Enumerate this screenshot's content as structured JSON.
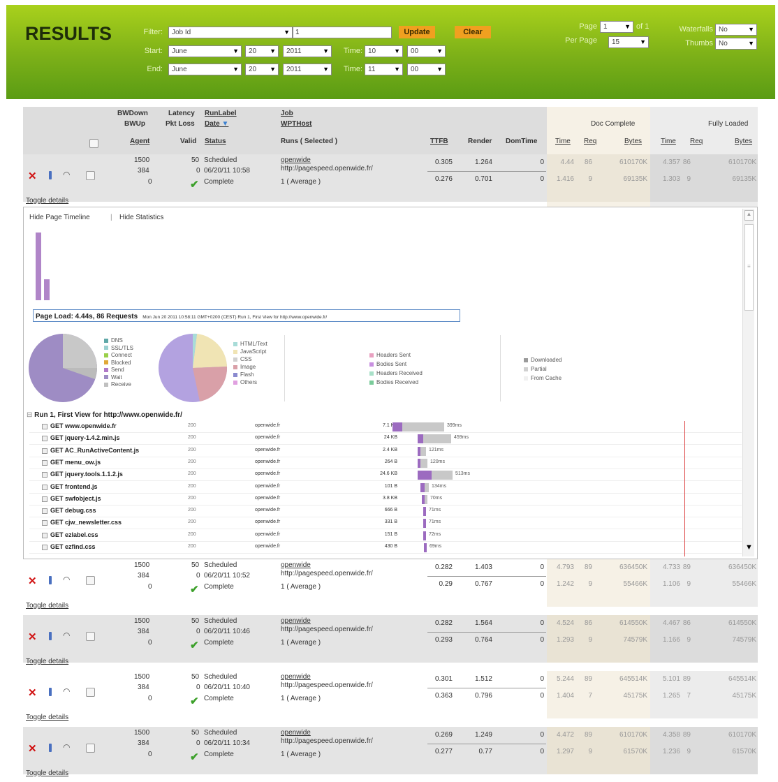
{
  "header": {
    "title": "RESULTS",
    "filter_label": "Filter:",
    "filter_value": "Job Id",
    "filter_input": "1",
    "update": "Update",
    "clear": "Clear",
    "start_label": "Start:",
    "end_label": "End:",
    "time_label": "Time:",
    "start": {
      "month": "June",
      "day": "20",
      "year": "2011",
      "hour": "10",
      "min": "00"
    },
    "end": {
      "month": "June",
      "day": "20",
      "year": "2011",
      "hour": "11",
      "min": "00"
    },
    "page_label": "Page",
    "page_value": "1",
    "of_label": "of 1",
    "perpage_label": "Per Page",
    "perpage_value": "15",
    "waterfalls_label": "Waterfalls",
    "waterfalls_value": "No",
    "thumbs_label": "Thumbs",
    "thumbs_value": "No"
  },
  "cols": {
    "bwdown": "BWDown",
    "bwup": "BWUp",
    "agent": "Agent",
    "latency": "Latency",
    "pktloss": "Pkt Loss",
    "valid": "Valid",
    "runlabel": "RunLabel",
    "date": "Date",
    "status": "Status",
    "job": "Job",
    "wpthost": "WPTHost",
    "runs": "Runs ( Selected )",
    "ttfb": "TTFB",
    "render": "Render",
    "domtime": "DomTime",
    "doc_complete": "Doc Complete",
    "fully_loaded": "Fully Loaded",
    "time": "Time",
    "req": "Req",
    "bytes": "Bytes"
  },
  "rows": [
    {
      "bw1": "1500",
      "bw2": "384",
      "bw3": "0",
      "valid": "50",
      "pkt": "0",
      "scheduled": "Scheduled",
      "date": "06/20/11 10:58",
      "status": "Complete",
      "job": "openwide",
      "url": "http://pagespeed.openwide.fr/",
      "run": "1 ( Average )",
      "ttfb1": "0.305",
      "ttfb2": "0.276",
      "render1": "1.264",
      "render2": "0.701",
      "dom1": "0",
      "dom2": "0",
      "dt1": "4.44",
      "dt2": "1.416",
      "dr1": "86",
      "dr2": "9",
      "db1": "610170K",
      "db2": "69135K",
      "ft1": "4.357",
      "ft2": "1.303",
      "fr1": "86",
      "fr2": "9",
      "fb1": "610170K",
      "fb2": "69135K",
      "toggle": "Toggle details"
    },
    {
      "bw1": "1500",
      "bw2": "384",
      "bw3": "0",
      "valid": "50",
      "pkt": "0",
      "scheduled": "Scheduled",
      "date": "06/20/11 10:52",
      "status": "Complete",
      "job": "openwide",
      "url": "http://pagespeed.openwide.fr/",
      "run": "1 ( Average )",
      "ttfb1": "0.282",
      "ttfb2": "0.29",
      "render1": "1.403",
      "render2": "0.767",
      "dom1": "0",
      "dom2": "0",
      "dt1": "4.793",
      "dt2": "1.242",
      "dr1": "89",
      "dr2": "9",
      "db1": "636450K",
      "db2": "55466K",
      "ft1": "4.733",
      "ft2": "1.106",
      "fr1": "89",
      "fr2": "9",
      "fb1": "636450K",
      "fb2": "55466K",
      "toggle": "Toggle details"
    },
    {
      "bw1": "1500",
      "bw2": "384",
      "bw3": "0",
      "valid": "50",
      "pkt": "0",
      "scheduled": "Scheduled",
      "date": "06/20/11 10:46",
      "status": "Complete",
      "job": "openwide",
      "url": "http://pagespeed.openwide.fr/",
      "run": "1 ( Average )",
      "ttfb1": "0.282",
      "ttfb2": "0.293",
      "render1": "1.564",
      "render2": "0.764",
      "dom1": "0",
      "dom2": "0",
      "dt1": "4.524",
      "dt2": "1.293",
      "dr1": "86",
      "dr2": "9",
      "db1": "614550K",
      "db2": "74579K",
      "ft1": "4.467",
      "ft2": "1.166",
      "fr1": "86",
      "fr2": "9",
      "fb1": "614550K",
      "fb2": "74579K",
      "toggle": "Toggle details"
    },
    {
      "bw1": "1500",
      "bw2": "384",
      "bw3": "0",
      "valid": "50",
      "pkt": "0",
      "scheduled": "Scheduled",
      "date": "06/20/11 10:40",
      "status": "Complete",
      "job": "openwide",
      "url": "http://pagespeed.openwide.fr/",
      "run": "1 ( Average )",
      "ttfb1": "0.301",
      "ttfb2": "0.363",
      "render1": "1.512",
      "render2": "0.796",
      "dom1": "0",
      "dom2": "0",
      "dt1": "5.244",
      "dt2": "1.404",
      "dr1": "89",
      "dr2": "7",
      "db1": "645514K",
      "db2": "45175K",
      "ft1": "5.101",
      "ft2": "1.265",
      "fr1": "89",
      "fr2": "7",
      "fb1": "645514K",
      "fb2": "45175K",
      "toggle": "Toggle details"
    },
    {
      "bw1": "1500",
      "bw2": "384",
      "bw3": "0",
      "valid": "50",
      "pkt": "0",
      "scheduled": "Scheduled",
      "date": "06/20/11 10:34",
      "status": "Complete",
      "job": "openwide",
      "url": "http://pagespeed.openwide.fr/",
      "run": "1 ( Average )",
      "ttfb1": "0.269",
      "ttfb2": "0.277",
      "render1": "1.249",
      "render2": "0.77",
      "dom1": "0",
      "dom2": "0",
      "dt1": "4.472",
      "dt2": "1.297",
      "dr1": "89",
      "dr2": "9",
      "db1": "610170K",
      "db2": "61570K",
      "ft1": "4.358",
      "ft2": "1.236",
      "fr1": "89",
      "fr2": "9",
      "fb1": "610170K",
      "fb2": "61570K",
      "toggle": "Toggle details"
    }
  ],
  "details": {
    "hide_timeline": "Hide Page Timeline",
    "sep": "|",
    "hide_stats": "Hide Statistics",
    "page_load": "Page Load: 4.44s, 86 Requests",
    "page_load_info": "Mon Jun 20 2011 10:58:11 GMT+0200 (CEST)   Run 1, First View for http://www.openwide.fr/",
    "legend1": [
      "DNS",
      "SSL/TLS",
      "Connect",
      "Blocked",
      "Send",
      "Wait",
      "Receive"
    ],
    "legend2": [
      "HTML/Text",
      "JavaScript",
      "CSS",
      "Image",
      "Flash",
      "Others"
    ],
    "legend3": [
      "Headers Sent",
      "Bodies Sent",
      "Headers Received",
      "Bodies Received"
    ],
    "legend4": [
      "Downloaded",
      "Partial",
      "From Cache"
    ],
    "run_title": "Run 1, First View for http://www.openwide.fr/",
    "requests": [
      {
        "name": "GET www.openwide.fr",
        "status": "200",
        "domain": "openwide.fr",
        "size": "7.1 KB",
        "time": "399ms"
      },
      {
        "name": "GET jquery-1.4.2.min.js",
        "status": "200",
        "domain": "openwide.fr",
        "size": "24 KB",
        "time": "459ms"
      },
      {
        "name": "GET AC_RunActiveContent.js",
        "status": "200",
        "domain": "openwide.fr",
        "size": "2.4 KB",
        "time": "121ms"
      },
      {
        "name": "GET menu_ow.js",
        "status": "200",
        "domain": "openwide.fr",
        "size": "264 B",
        "time": "120ms"
      },
      {
        "name": "GET jquery.tools.1.1.2.js",
        "status": "200",
        "domain": "openwide.fr",
        "size": "24.6 KB",
        "time": "513ms"
      },
      {
        "name": "GET frontend.js",
        "status": "200",
        "domain": "openwide.fr",
        "size": "101 B",
        "time": "134ms"
      },
      {
        "name": "GET swfobject.js",
        "status": "200",
        "domain": "openwide.fr",
        "size": "3.8 KB",
        "time": "70ms"
      },
      {
        "name": "GET debug.css",
        "status": "200",
        "domain": "openwide.fr",
        "size": "666 B",
        "time": "71ms"
      },
      {
        "name": "GET cjw_newsletter.css",
        "status": "200",
        "domain": "openwide.fr",
        "size": "331 B",
        "time": "71ms"
      },
      {
        "name": "GET ezlabel.css",
        "status": "200",
        "domain": "openwide.fr",
        "size": "151 B",
        "time": "72ms"
      },
      {
        "name": "GET ezfind.css",
        "status": "200",
        "domain": "openwide.fr",
        "size": "430 B",
        "time": "69ms"
      }
    ]
  }
}
